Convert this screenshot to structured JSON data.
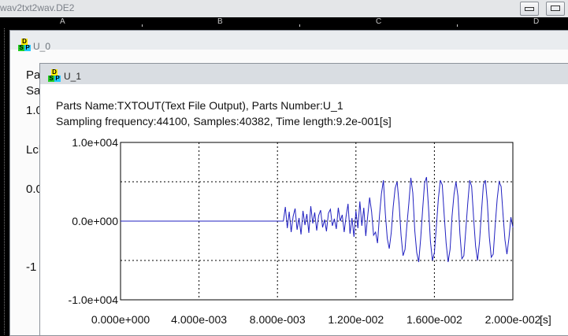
{
  "app": {
    "title": "wav2txt2wav.DE2"
  },
  "ruler": {
    "labels": [
      "A",
      "B",
      "C",
      "D"
    ]
  },
  "window_u0": {
    "title": "U_0",
    "fragments": [
      "Par",
      "Sa",
      "1.0",
      "Lch",
      "0.0",
      "-1"
    ]
  },
  "window_u1": {
    "title": "U_1",
    "info_line1": "Parts Name:TXTOUT(Text File Output), Parts Number:U_1",
    "info_line2": "Sampling frequency:44100, Samples:40382, Time length:9.2e-001[s]"
  },
  "dsp_icon": {
    "letters": [
      "D",
      "S",
      "P"
    ]
  },
  "colors": {
    "signal": "#2020c0",
    "plot_bg": "#ffffff",
    "grid": "#000000"
  },
  "chart_data": {
    "type": "line",
    "title": "",
    "xlabel": "",
    "ylabel": "",
    "x_unit": "[s]",
    "xlim": [
      0,
      0.02
    ],
    "ylim": [
      -10000,
      10000
    ],
    "grid": true,
    "y_ticks": [
      "1.0e+004",
      "0.0e+000",
      "-1.0e+004"
    ],
    "x_ticks": [
      "0.000e+000",
      "4.000e-003",
      "8.000e-003",
      "1.200e-002",
      "1.600e-002",
      "2.000e-002"
    ],
    "series": [
      {
        "x": [
          0,
          0.0083,
          0.0084,
          0.0085,
          0.0086,
          0.0087,
          0.0088,
          0.0089,
          0.009,
          0.0091,
          0.0092,
          0.0093,
          0.0094,
          0.0095,
          0.0096,
          0.0097,
          0.0098,
          0.0099,
          0.01,
          0.0101,
          0.0102,
          0.0103,
          0.0104,
          0.0105,
          0.0106,
          0.0107,
          0.0108,
          0.0109,
          0.011,
          0.0111,
          0.0112,
          0.0113,
          0.0114,
          0.0115,
          0.0116,
          0.0117,
          0.0118,
          0.0119,
          0.012,
          0.0121,
          0.0122,
          0.0123,
          0.0124,
          0.0125,
          0.0126,
          0.0127,
          0.0128,
          0.0129,
          0.013,
          0.0131,
          0.0132,
          0.0133,
          0.0134,
          0.0135,
          0.0136,
          0.0137,
          0.0138,
          0.0139,
          0.014,
          0.0141,
          0.0142,
          0.0143,
          0.0144,
          0.0145,
          0.0146,
          0.0147,
          0.0148,
          0.0149,
          0.015,
          0.0151,
          0.0152,
          0.0153,
          0.0154,
          0.0155,
          0.0156,
          0.0157,
          0.0158,
          0.0159,
          0.016,
          0.0161,
          0.0162,
          0.0163,
          0.0164,
          0.0165,
          0.0166,
          0.0167,
          0.0168,
          0.0169,
          0.017,
          0.0171,
          0.0172,
          0.0173,
          0.0174,
          0.0175,
          0.0176,
          0.0177,
          0.0178,
          0.0179,
          0.018,
          0.0181,
          0.0182,
          0.0183,
          0.0184,
          0.0185,
          0.0186,
          0.0187,
          0.0188,
          0.0189,
          0.019,
          0.0191,
          0.0192,
          0.0193,
          0.0194,
          0.0195,
          0.0196,
          0.0197,
          0.0198,
          0.0199,
          0.02
        ],
        "y": [
          0,
          0,
          1800,
          -900,
          1200,
          -1400,
          600,
          1600,
          -1100,
          400,
          -1700,
          1300,
          -500,
          900,
          -1500,
          1900,
          -300,
          1100,
          -1200,
          700,
          1400,
          -800,
          200,
          -1300,
          1000,
          1500,
          -600,
          300,
          -1000,
          1700,
          0,
          800,
          -1400,
          600,
          2200,
          -1600,
          400,
          -2000,
          1300,
          -900,
          2500,
          -600,
          1700,
          -1900,
          600,
          3000,
          1200,
          -1800,
          -1400,
          -2800,
          700,
          3500,
          5200,
          1000,
          -2200,
          -3500,
          -1500,
          1800,
          4200,
          5000,
          2200,
          -1800,
          -4400,
          -3600,
          -500,
          2300,
          5500,
          3600,
          -1200,
          -4000,
          -5200,
          -2200,
          1500,
          4800,
          5600,
          1800,
          -2600,
          -5000,
          -4000,
          -700,
          2800,
          5200,
          4600,
          700,
          -2800,
          -5200,
          -3600,
          600,
          3400,
          5000,
          3200,
          -1600,
          -4800,
          -4400,
          -1200,
          2200,
          5200,
          4400,
          400,
          -3200,
          -5000,
          -2600,
          1200,
          4600,
          5200,
          2400,
          -2000,
          -4600,
          -4200,
          -500,
          2800,
          5000,
          4400,
          900,
          -2400,
          -4200,
          -2200,
          500,
          -800
        ]
      }
    ]
  }
}
